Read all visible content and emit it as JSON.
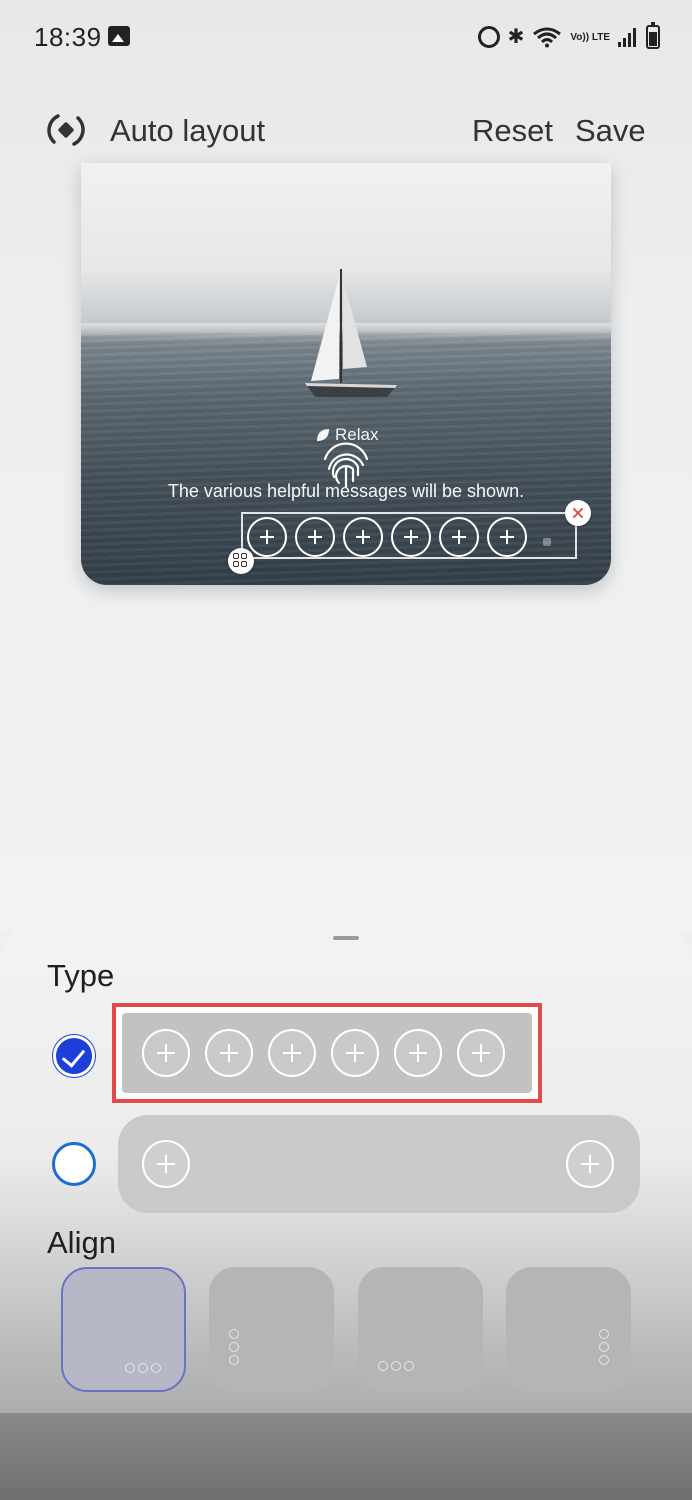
{
  "status_bar": {
    "time": "18:39",
    "icons": [
      "gallery-icon",
      "alarm-icon",
      "bluetooth-icon",
      "wifi-icon",
      "volte-icon",
      "signal-icon",
      "battery-icon"
    ],
    "volte_text": "Vo)) LTE"
  },
  "header": {
    "icon": "auto-layout-icon",
    "title": "Auto layout",
    "reset_label": "Reset",
    "save_label": "Save"
  },
  "preview": {
    "mode_label": "Relax",
    "helpful_message": "The various helpful messages will be shown.",
    "shortcut_count": 6
  },
  "sheet": {
    "type_label": "Type",
    "type_options": [
      {
        "name": "row-of-six",
        "selected": true
      },
      {
        "name": "left-and-right",
        "selected": false
      }
    ],
    "align_label": "Align",
    "align_options": [
      {
        "name": "bottom-right-horizontal",
        "selected": true
      },
      {
        "name": "left-vertical",
        "selected": false
      },
      {
        "name": "bottom-left-horizontal",
        "selected": false
      },
      {
        "name": "right-vertical",
        "selected": false
      }
    ]
  },
  "colors": {
    "accent": "#1b3fd8",
    "radio_outline": "#1a6fd6",
    "highlight": "#e24b4b"
  }
}
